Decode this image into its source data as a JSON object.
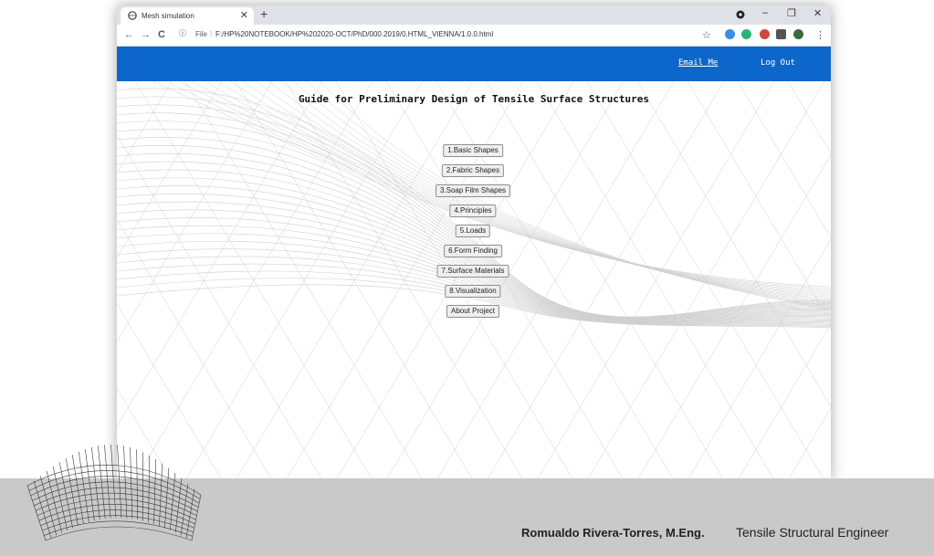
{
  "browser": {
    "tab_title": "Mesh simulation",
    "tab_close": "✕",
    "new_tab": "+",
    "window_controls": {
      "minimize": "–",
      "maximize": "❐",
      "close": "✕"
    },
    "nav": {
      "back": "←",
      "forward": "→",
      "reload": "C"
    },
    "address": {
      "info": "ⓘ",
      "scheme_label": "File",
      "url": "F:/HP%20NOTEBOOK/HP%202020-OCT/PhD/000.2019/0.HTML_VIENNA/1.0.0.html"
    },
    "bookmark_star": "☆",
    "menu": "⋮"
  },
  "header": {
    "email_label": "Email Me",
    "logout_label": "Log Out"
  },
  "page_title": "Guide for Preliminary Design of Tensile Surface Structures",
  "menu": [
    "1.Basic Shapes",
    "2.Fabric Shapes",
    "3.Soap Film Shapes",
    "4.Principles",
    "5.Loads",
    "6.Form Finding",
    "7.Surface Materials",
    "8.Visualization",
    "About Project"
  ],
  "footer": {
    "author": "Romualdo Rivera-Torres, M.Eng.",
    "role": "Tensile Structural Engineer"
  },
  "colors": {
    "header_bar": "#0d66c9",
    "footer_band": "#c9c9c9",
    "mesh_line": "#cfcfcf"
  }
}
